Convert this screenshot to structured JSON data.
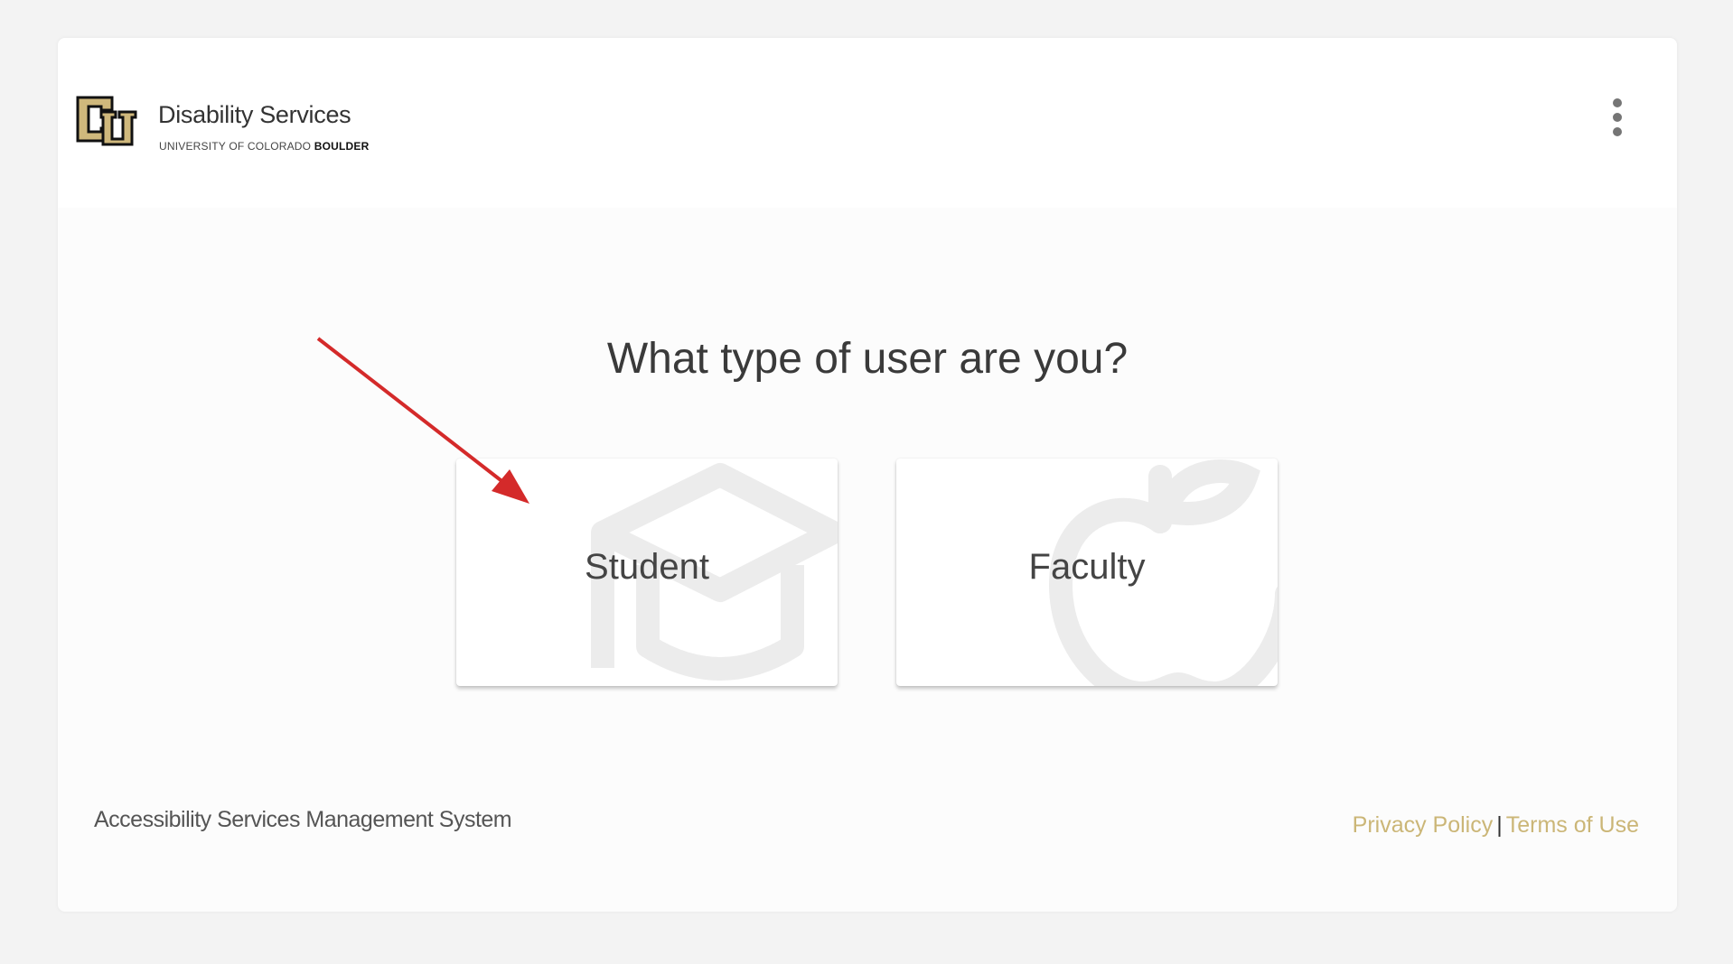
{
  "header": {
    "brand_title": "Disability Services",
    "brand_sub_prefix": "UNIVERSITY OF COLORADO",
    "brand_sub_bold": "BOULDER",
    "logo_icon": "cu-logo-icon",
    "menu_icon": "more-vert-icon"
  },
  "main": {
    "question": "What type of user are you?",
    "choices": [
      {
        "label": "Student",
        "icon": "graduation-cap-icon"
      },
      {
        "label": "Faculty",
        "icon": "apple-icon"
      }
    ]
  },
  "footer": {
    "system_name": "Accessibility Services Management System",
    "privacy_label": "Privacy Policy",
    "separator": "|",
    "terms_label": "Terms of Use"
  },
  "colors": {
    "link_gold": "#cbb677",
    "annotation_arrow": "#d42a2a",
    "logo_gold": "#cfb87c"
  }
}
